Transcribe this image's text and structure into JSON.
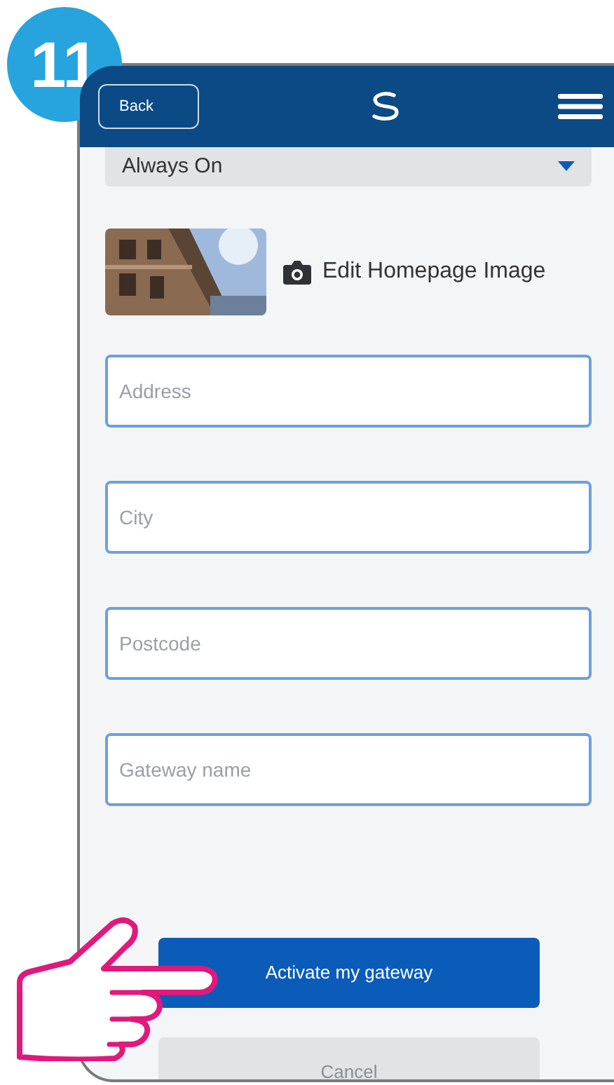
{
  "step_badge": "11",
  "header": {
    "back_button": "Back"
  },
  "dropdown": {
    "value": "Always On"
  },
  "homepage_image": {
    "kind": "picture",
    "edit_label": "Edit Homepage Image"
  },
  "fields": [
    {
      "placeholder": "Address"
    },
    {
      "placeholder": "City"
    },
    {
      "placeholder": "Postcode"
    },
    {
      "placeholder": "Gateway name"
    }
  ],
  "buttons": [
    {
      "label": "Activate my gateway",
      "kind": "primary"
    },
    {
      "label": "Cancel",
      "kind": "secondary"
    }
  ]
}
